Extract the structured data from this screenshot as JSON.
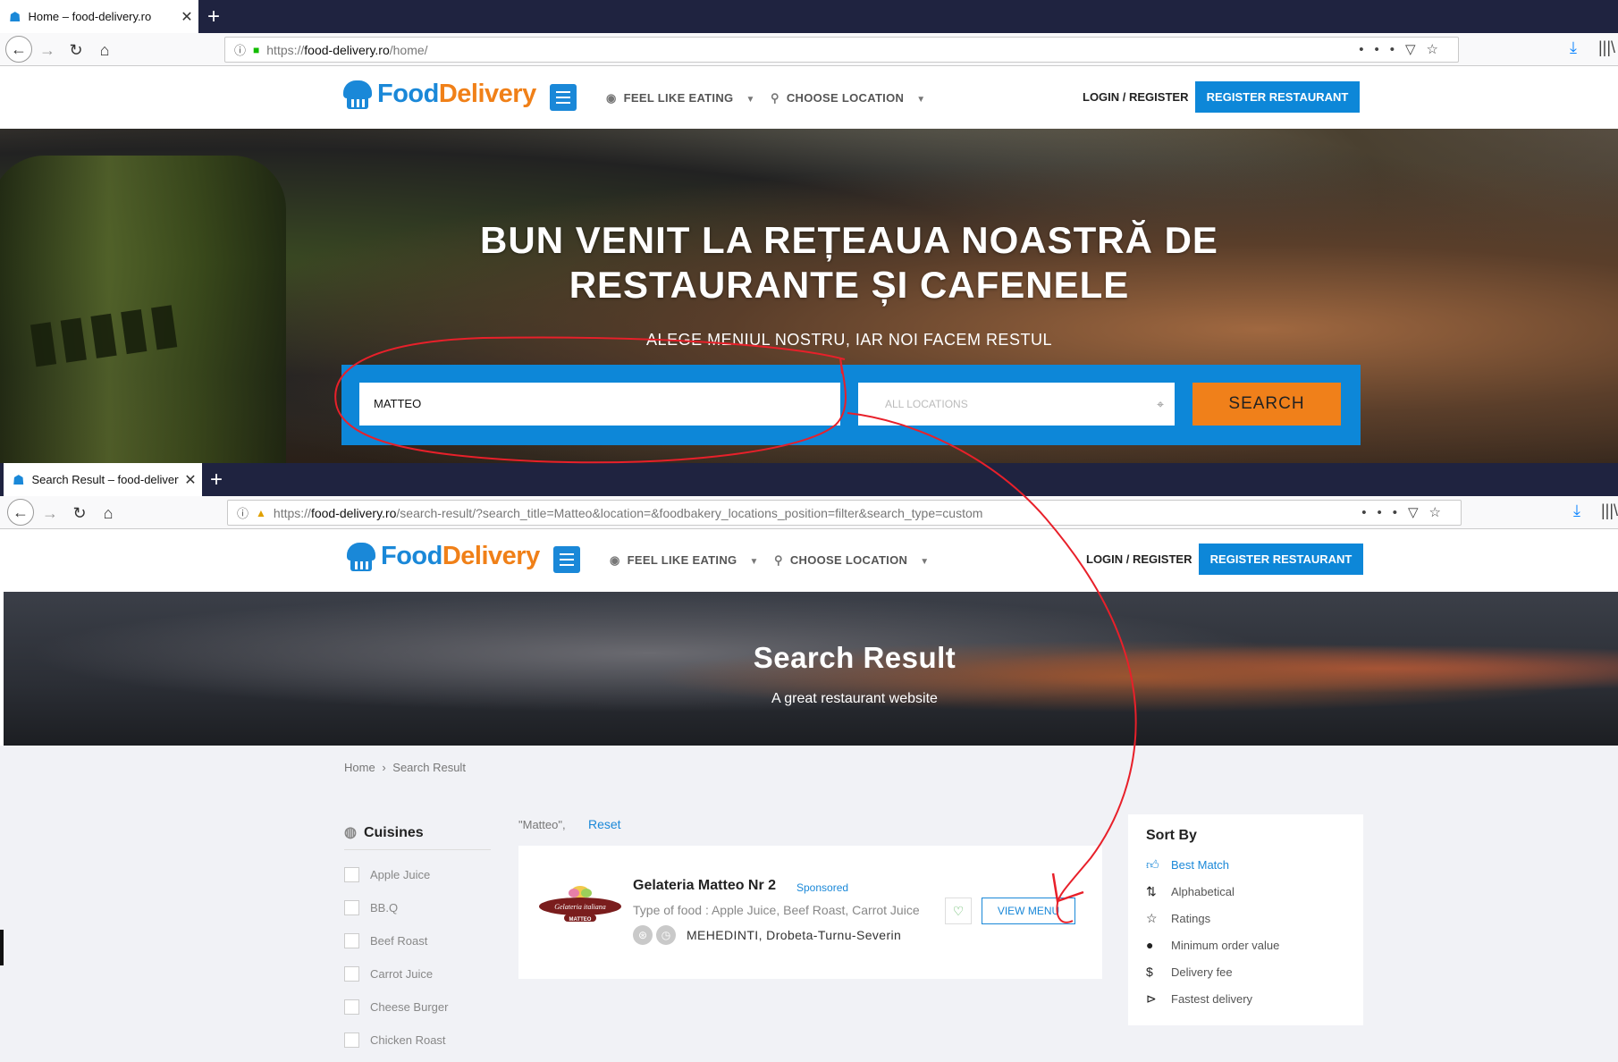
{
  "browser_top": {
    "tab_title": "Home – food-delivery.ro",
    "url_scheme": "https://",
    "url_host": "food-delivery.ro",
    "url_path": "/home/"
  },
  "site": {
    "logo_food": "Food",
    "logo_delivery": "Delivery",
    "nav_feel": "FEEL LIKE EATING",
    "nav_location": "CHOOSE LOCATION",
    "login": "LOGIN / REGISTER",
    "register": "REGISTER RESTAURANT"
  },
  "hero": {
    "title_line1": "BUN VENIT LA REȚEAUA NOASTRĂ DE",
    "title_line2": "RESTAURANTE ȘI CAFENELE",
    "subtitle": "ALEGE MENIUL NOSTRU, IAR NOI FACEM RESTUL",
    "search_value": "MATTEO",
    "location_placeholder": "ALL LOCATIONS",
    "search_button": "SEARCH"
  },
  "browser_bottom": {
    "tab_title": "Search Result – food-delivery.ro",
    "url_scheme": "https://",
    "url_host": "food-delivery.ro",
    "url_path": "/search-result/?search_title=Matteo&location=&foodbakery_locations_position=filter&search_type=custom"
  },
  "results_page": {
    "banner_title": "Search Result",
    "banner_subtitle": "A great restaurant website",
    "breadcrumb_home": "Home",
    "breadcrumb_sep": "›",
    "breadcrumb_current": "Search Result",
    "cuisines_title": "Cuisines",
    "cuisines": [
      "Apple Juice",
      "BB.Q",
      "Beef Roast",
      "Carrot Juice",
      "Cheese Burger",
      "Chicken Roast"
    ],
    "query_tag": "\"Matteo\",",
    "reset": "Reset",
    "result": {
      "name": "Gelateria Matteo Nr 2",
      "badge": "Sponsored",
      "type": "Type of food : Apple Juice, Beef Roast, Carrot Juice",
      "location": "MEHEDINTI, Drobeta-Turnu-Severin",
      "view_menu": "VIEW MENU",
      "logo_text": "Gelateria italiana",
      "logo_sub": "MATTEO"
    },
    "sort_title": "Sort By",
    "sort_options": [
      "Best Match",
      "Alphabetical",
      "Ratings",
      "Minimum order value",
      "Delivery fee",
      "Fastest delivery"
    ]
  },
  "colors": {
    "brand_blue": "#1a88d8",
    "brand_orange": "#f08018",
    "annotation_red": "#e8202a"
  }
}
